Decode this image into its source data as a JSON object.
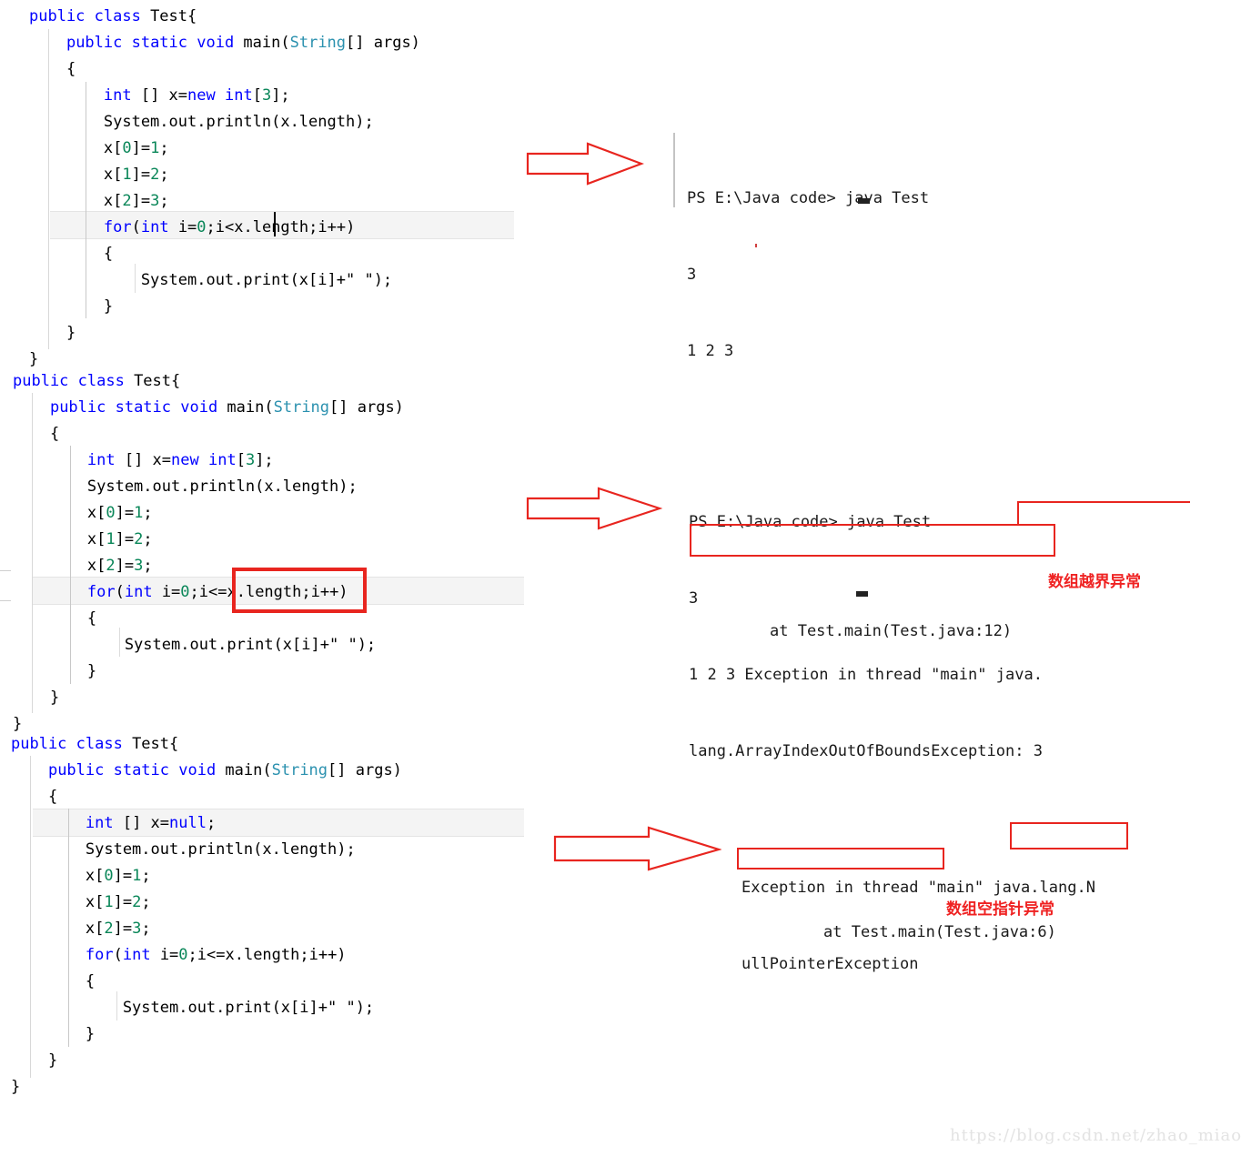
{
  "snippets": [
    {
      "id": "snippet-1",
      "lines": [
        [
          {
            "t": "public class ",
            "c": "kw"
          },
          {
            "t": "Test{",
            "c": "plain"
          }
        ],
        [
          {
            "t": "    ",
            "c": "plain"
          },
          {
            "t": "public static void ",
            "c": "kw"
          },
          {
            "t": "main(",
            "c": "plain"
          },
          {
            "t": "String",
            "c": "cls"
          },
          {
            "t": "[] args)",
            "c": "plain"
          }
        ],
        [
          {
            "t": "    {",
            "c": "plain"
          }
        ],
        [
          {
            "t": "        ",
            "c": "plain"
          },
          {
            "t": "int",
            "c": "kw"
          },
          {
            "t": " [] x=",
            "c": "plain"
          },
          {
            "t": "new int",
            "c": "kw"
          },
          {
            "t": "[",
            "c": "plain"
          },
          {
            "t": "3",
            "c": "num"
          },
          {
            "t": "];",
            "c": "plain"
          }
        ],
        [
          {
            "t": "        System.out.println(x.length);",
            "c": "plain"
          }
        ],
        [
          {
            "t": "        x[",
            "c": "plain"
          },
          {
            "t": "0",
            "c": "num"
          },
          {
            "t": "]=",
            "c": "plain"
          },
          {
            "t": "1",
            "c": "num"
          },
          {
            "t": ";",
            "c": "plain"
          }
        ],
        [
          {
            "t": "        x[",
            "c": "plain"
          },
          {
            "t": "1",
            "c": "num"
          },
          {
            "t": "]=",
            "c": "plain"
          },
          {
            "t": "2",
            "c": "num"
          },
          {
            "t": ";",
            "c": "plain"
          }
        ],
        [
          {
            "t": "        x[",
            "c": "plain"
          },
          {
            "t": "2",
            "c": "num"
          },
          {
            "t": "]=",
            "c": "plain"
          },
          {
            "t": "3",
            "c": "num"
          },
          {
            "t": ";",
            "c": "plain"
          }
        ],
        [
          {
            "t": "        ",
            "c": "plain"
          },
          {
            "t": "for",
            "c": "kw"
          },
          {
            "t": "(",
            "c": "plain"
          },
          {
            "t": "int",
            "c": "kw"
          },
          {
            "t": " i=",
            "c": "plain"
          },
          {
            "t": "0",
            "c": "num"
          },
          {
            "t": ";i<x.length;i++)",
            "c": "plain"
          }
        ],
        [
          {
            "t": "        {",
            "c": "plain"
          }
        ],
        [
          {
            "t": "            System.out.print(x[i]+\" \");",
            "c": "plain"
          }
        ],
        [
          {
            "t": "        }",
            "c": "plain"
          }
        ],
        [
          {
            "t": "    }",
            "c": "plain"
          }
        ],
        [
          {
            "t": "}",
            "c": "plain"
          }
        ]
      ]
    },
    {
      "id": "snippet-2",
      "lines": [
        [
          {
            "t": "public class ",
            "c": "kw"
          },
          {
            "t": "Test{",
            "c": "plain"
          }
        ],
        [
          {
            "t": "    ",
            "c": "plain"
          },
          {
            "t": "public static void ",
            "c": "kw"
          },
          {
            "t": "main(",
            "c": "plain"
          },
          {
            "t": "String",
            "c": "cls"
          },
          {
            "t": "[] args)",
            "c": "plain"
          }
        ],
        [
          {
            "t": "    {",
            "c": "plain"
          }
        ],
        [
          {
            "t": "        ",
            "c": "plain"
          },
          {
            "t": "int",
            "c": "kw"
          },
          {
            "t": " [] x=",
            "c": "plain"
          },
          {
            "t": "new int",
            "c": "kw"
          },
          {
            "t": "[",
            "c": "plain"
          },
          {
            "t": "3",
            "c": "num"
          },
          {
            "t": "];",
            "c": "plain"
          }
        ],
        [
          {
            "t": "        System.out.println(x.length);",
            "c": "plain"
          }
        ],
        [
          {
            "t": "        x[",
            "c": "plain"
          },
          {
            "t": "0",
            "c": "num"
          },
          {
            "t": "]=",
            "c": "plain"
          },
          {
            "t": "1",
            "c": "num"
          },
          {
            "t": ";",
            "c": "plain"
          }
        ],
        [
          {
            "t": "        x[",
            "c": "plain"
          },
          {
            "t": "1",
            "c": "num"
          },
          {
            "t": "]=",
            "c": "plain"
          },
          {
            "t": "2",
            "c": "num"
          },
          {
            "t": ";",
            "c": "plain"
          }
        ],
        [
          {
            "t": "        x[",
            "c": "plain"
          },
          {
            "t": "2",
            "c": "num"
          },
          {
            "t": "]=",
            "c": "plain"
          },
          {
            "t": "3",
            "c": "num"
          },
          {
            "t": ";",
            "c": "plain"
          }
        ],
        [
          {
            "t": "        ",
            "c": "plain"
          },
          {
            "t": "for",
            "c": "kw"
          },
          {
            "t": "(",
            "c": "plain"
          },
          {
            "t": "int",
            "c": "kw"
          },
          {
            "t": " i=",
            "c": "plain"
          },
          {
            "t": "0",
            "c": "num"
          },
          {
            "t": ";i<=x.length;i++)",
            "c": "plain"
          }
        ],
        [
          {
            "t": "        {",
            "c": "plain"
          }
        ],
        [
          {
            "t": "            System.out.print(x[i]+\" \");",
            "c": "plain"
          }
        ],
        [
          {
            "t": "        }",
            "c": "plain"
          }
        ],
        [
          {
            "t": "    }",
            "c": "plain"
          }
        ],
        [
          {
            "t": "}",
            "c": "plain"
          }
        ]
      ]
    },
    {
      "id": "snippet-3",
      "lines": [
        [
          {
            "t": "public class ",
            "c": "kw"
          },
          {
            "t": "Test{",
            "c": "plain"
          }
        ],
        [
          {
            "t": "    ",
            "c": "plain"
          },
          {
            "t": "public static void ",
            "c": "kw"
          },
          {
            "t": "main(",
            "c": "plain"
          },
          {
            "t": "String",
            "c": "cls"
          },
          {
            "t": "[] args)",
            "c": "plain"
          }
        ],
        [
          {
            "t": "    {",
            "c": "plain"
          }
        ],
        [
          {
            "t": "        ",
            "c": "plain"
          },
          {
            "t": "int",
            "c": "kw"
          },
          {
            "t": " [] x=",
            "c": "plain"
          },
          {
            "t": "null",
            "c": "kw"
          },
          {
            "t": ";",
            "c": "plain"
          }
        ],
        [
          {
            "t": "        System.out.println(x.length);",
            "c": "plain"
          }
        ],
        [
          {
            "t": "        x[",
            "c": "plain"
          },
          {
            "t": "0",
            "c": "num"
          },
          {
            "t": "]=",
            "c": "plain"
          },
          {
            "t": "1",
            "c": "num"
          },
          {
            "t": ";",
            "c": "plain"
          }
        ],
        [
          {
            "t": "        x[",
            "c": "plain"
          },
          {
            "t": "1",
            "c": "num"
          },
          {
            "t": "]=",
            "c": "plain"
          },
          {
            "t": "2",
            "c": "num"
          },
          {
            "t": ";",
            "c": "plain"
          }
        ],
        [
          {
            "t": "        x[",
            "c": "plain"
          },
          {
            "t": "2",
            "c": "num"
          },
          {
            "t": "]=",
            "c": "plain"
          },
          {
            "t": "3",
            "c": "num"
          },
          {
            "t": ";",
            "c": "plain"
          }
        ],
        [
          {
            "t": "        ",
            "c": "plain"
          },
          {
            "t": "for",
            "c": "kw"
          },
          {
            "t": "(",
            "c": "plain"
          },
          {
            "t": "int",
            "c": "kw"
          },
          {
            "t": " i=",
            "c": "plain"
          },
          {
            "t": "0",
            "c": "num"
          },
          {
            "t": ";i<=x.length;i++)",
            "c": "plain"
          }
        ],
        [
          {
            "t": "        {",
            "c": "plain"
          }
        ],
        [
          {
            "t": "            System.out.print(x[i]+\" \");",
            "c": "plain"
          }
        ],
        [
          {
            "t": "        }",
            "c": "plain"
          }
        ],
        [
          {
            "t": "    }",
            "c": "plain"
          }
        ],
        [
          {
            "t": "}",
            "c": "plain"
          }
        ]
      ]
    }
  ],
  "consoles": {
    "first": {
      "prompt": "PS E:\\Java code> java Test",
      "line_length": "3",
      "line_values": "1 2 3"
    },
    "second": {
      "prompt": "PS E:\\Java code> java Test",
      "line_length": "3",
      "line_exception_1": "1 2 3 Exception in thread \"main\" java.",
      "line_exception_2": "lang.ArrayIndexOutOfBoundsException: 3",
      "line_stack": "at Test.main(Test.java:12)"
    },
    "third": {
      "line_exception_1": "Exception in thread \"main\" java.lang.N",
      "line_exception_2": "ullPointerException",
      "line_stack": "at Test.main(Test.java:6)"
    }
  },
  "annotations": {
    "note_array_index": "数组越界异常",
    "note_null_pointer": "数组空指针异常",
    "accent_red": "#e8251f",
    "note_red": "#ef2222"
  },
  "watermark": {
    "text": "https://blog.csdn.net/zhao_miao"
  }
}
